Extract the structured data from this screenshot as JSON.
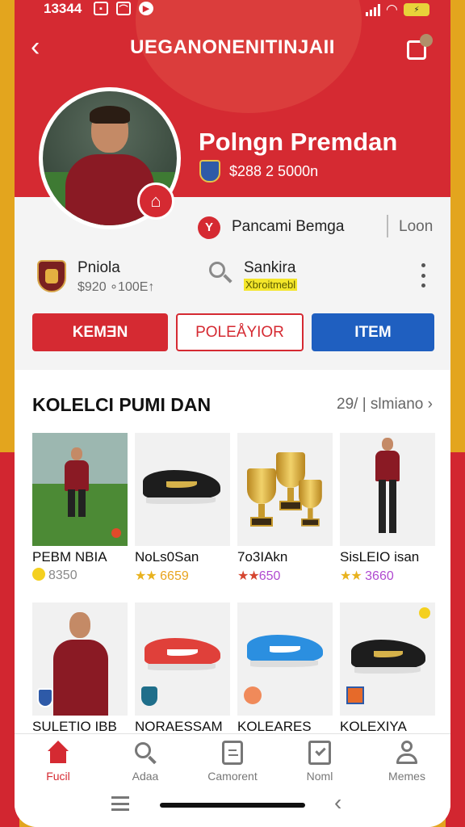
{
  "status_bar": {
    "time": "13344"
  },
  "header": {
    "title": "UEGANONENITINJAII",
    "profile_name": "Polngn Premdan",
    "balance": "$288 2 5000n"
  },
  "info": {
    "club_name": "Pancami Bemga",
    "club_link": "Loon",
    "stat1": {
      "title": "Pniola",
      "value": "$920 ∘100E↑"
    },
    "stat2": {
      "title": "Sankira",
      "value": "Xbroitmebl"
    }
  },
  "actions": {
    "primary": "KEMƎN",
    "secondary": "POLEÅYIOR",
    "tertiary": "ITEM"
  },
  "collection": {
    "title": "KOLELCI PUMI DAN",
    "more": "29/ | slmiano",
    "items": [
      {
        "name": "PEBM NBIA",
        "rating": "8350"
      },
      {
        "name": "NoLs0San",
        "rating": "6659"
      },
      {
        "name": "7o3IAkn",
        "rating": "650"
      },
      {
        "name": "SisLEIO isan",
        "rating": "3660"
      },
      {
        "name": "SULETIO IBB",
        "rating": ""
      },
      {
        "name": "NORAESSAM",
        "rating": ""
      },
      {
        "name": "KOLEARES",
        "rating": ""
      },
      {
        "name": "KOLEXIYA",
        "rating": ""
      }
    ]
  },
  "nav": [
    {
      "label": "Fucil"
    },
    {
      "label": "Adaa"
    },
    {
      "label": "Camorent"
    },
    {
      "label": "Noml"
    },
    {
      "label": "Memes"
    }
  ],
  "colors": {
    "primary_red": "#d52a32",
    "blue": "#1f5fc0",
    "gold": "#e3a51e"
  }
}
